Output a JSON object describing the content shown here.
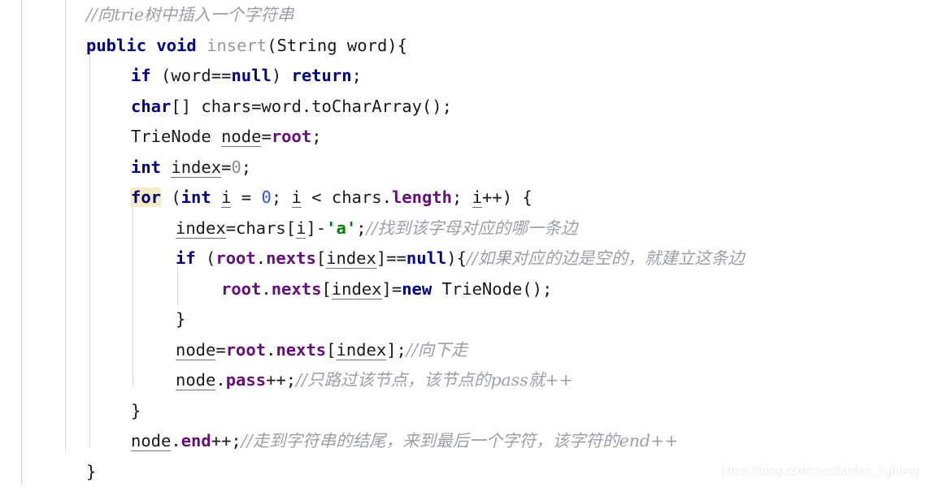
{
  "watermark": {
    "text": "https://blog.csdn.net/fanfan_fighting"
  },
  "colors": {
    "background": "#ffffff",
    "keyword": "#000080",
    "field": "#660e7a",
    "comment": "#9aa0a6",
    "string": "#008000",
    "method": "#9a9a9a",
    "number": "#8f8f8f",
    "highlight": "#f6ebc4",
    "indent_guide": "#d8d8d8",
    "watermark": "#eeeeee"
  },
  "editor": {
    "language": "Java",
    "indent_guides": 5,
    "highlighted_token": "for"
  },
  "code": {
    "lines": [
      {
        "indent": "i1",
        "tokens": [
          {
            "cls": "tk-comment",
            "text": "//向trie树中插入一个字符串"
          }
        ]
      },
      {
        "indent": "i1",
        "tokens": [
          {
            "cls": "tk-keyword",
            "text": "public"
          },
          {
            "cls": "tk-plain",
            "text": " "
          },
          {
            "cls": "tk-keyword",
            "text": "void"
          },
          {
            "cls": "tk-plain",
            "text": " "
          },
          {
            "cls": "tk-method",
            "text": "insert"
          },
          {
            "cls": "tk-plain",
            "text": "(String word){"
          }
        ]
      },
      {
        "indent": "i2",
        "tokens": [
          {
            "cls": "tk-keyword",
            "text": "if"
          },
          {
            "cls": "tk-plain",
            "text": " (word=="
          },
          {
            "cls": "tk-keyword",
            "text": "null"
          },
          {
            "cls": "tk-plain",
            "text": ") "
          },
          {
            "cls": "tk-keyword",
            "text": "return"
          },
          {
            "cls": "tk-plain",
            "text": ";"
          }
        ]
      },
      {
        "indent": "i2",
        "tokens": [
          {
            "cls": "tk-keyword",
            "text": "char"
          },
          {
            "cls": "tk-plain",
            "text": "[] chars=word.toCharArray();"
          }
        ]
      },
      {
        "indent": "i2",
        "tokens": [
          {
            "cls": "tk-type",
            "text": "TrieNode "
          },
          {
            "cls": "tk-local",
            "text": "node"
          },
          {
            "cls": "tk-plain",
            "text": "="
          },
          {
            "cls": "tk-field",
            "text": "root"
          },
          {
            "cls": "tk-plain",
            "text": ";"
          }
        ]
      },
      {
        "indent": "i2",
        "tokens": [
          {
            "cls": "tk-keyword",
            "text": "int"
          },
          {
            "cls": "tk-plain",
            "text": " "
          },
          {
            "cls": "tk-local",
            "text": "index"
          },
          {
            "cls": "tk-plain",
            "text": "="
          },
          {
            "cls": "tk-num",
            "text": "0"
          },
          {
            "cls": "tk-plain",
            "text": ";"
          }
        ]
      },
      {
        "indent": "i2",
        "tokens": [
          {
            "cls": "tk-keyword tk-hl",
            "text": "for"
          },
          {
            "cls": "tk-plain",
            "text": " ("
          },
          {
            "cls": "tk-keyword",
            "text": "int"
          },
          {
            "cls": "tk-plain",
            "text": " "
          },
          {
            "cls": "tk-local",
            "text": "i"
          },
          {
            "cls": "tk-plain",
            "text": " = "
          },
          {
            "cls": "tk-numblue",
            "text": "0"
          },
          {
            "cls": "tk-plain",
            "text": "; "
          },
          {
            "cls": "tk-local",
            "text": "i"
          },
          {
            "cls": "tk-plain",
            "text": " < chars."
          },
          {
            "cls": "tk-field",
            "text": "length"
          },
          {
            "cls": "tk-plain",
            "text": "; "
          },
          {
            "cls": "tk-local",
            "text": "i"
          },
          {
            "cls": "tk-plain",
            "text": "++) {"
          }
        ]
      },
      {
        "indent": "i3",
        "tokens": [
          {
            "cls": "tk-local",
            "text": "index"
          },
          {
            "cls": "tk-plain",
            "text": "=chars["
          },
          {
            "cls": "tk-local",
            "text": "i"
          },
          {
            "cls": "tk-plain",
            "text": "]-"
          },
          {
            "cls": "tk-string",
            "text": "'a'"
          },
          {
            "cls": "tk-plain",
            "text": ";"
          },
          {
            "cls": "tk-comment",
            "text": "//找到该字母对应的哪一条边"
          }
        ]
      },
      {
        "indent": "i3",
        "tokens": [
          {
            "cls": "tk-keyword",
            "text": "if"
          },
          {
            "cls": "tk-plain",
            "text": " ("
          },
          {
            "cls": "tk-field",
            "text": "root"
          },
          {
            "cls": "tk-plain",
            "text": "."
          },
          {
            "cls": "tk-field",
            "text": "nexts"
          },
          {
            "cls": "tk-plain",
            "text": "["
          },
          {
            "cls": "tk-local",
            "text": "index"
          },
          {
            "cls": "tk-plain",
            "text": "]=="
          },
          {
            "cls": "tk-keyword",
            "text": "null"
          },
          {
            "cls": "tk-plain",
            "text": "){"
          },
          {
            "cls": "tk-comment",
            "text": "//如果对应的边是空的，就建立这条边"
          }
        ]
      },
      {
        "indent": "i4",
        "tokens": [
          {
            "cls": "tk-field",
            "text": "root"
          },
          {
            "cls": "tk-plain",
            "text": "."
          },
          {
            "cls": "tk-field",
            "text": "nexts"
          },
          {
            "cls": "tk-plain",
            "text": "["
          },
          {
            "cls": "tk-local",
            "text": "index"
          },
          {
            "cls": "tk-plain",
            "text": "]="
          },
          {
            "cls": "tk-keyword",
            "text": "new"
          },
          {
            "cls": "tk-plain",
            "text": " TrieNode();"
          }
        ]
      },
      {
        "indent": "i3",
        "tokens": [
          {
            "cls": "tk-plain",
            "text": "}"
          }
        ]
      },
      {
        "indent": "i3",
        "tokens": [
          {
            "cls": "tk-local",
            "text": "node"
          },
          {
            "cls": "tk-plain",
            "text": "="
          },
          {
            "cls": "tk-field",
            "text": "root"
          },
          {
            "cls": "tk-plain",
            "text": "."
          },
          {
            "cls": "tk-field",
            "text": "nexts"
          },
          {
            "cls": "tk-plain",
            "text": "["
          },
          {
            "cls": "tk-local",
            "text": "index"
          },
          {
            "cls": "tk-plain",
            "text": "];"
          },
          {
            "cls": "tk-comment",
            "text": "//向下走"
          }
        ]
      },
      {
        "indent": "i3",
        "tokens": [
          {
            "cls": "tk-local",
            "text": "node"
          },
          {
            "cls": "tk-plain",
            "text": "."
          },
          {
            "cls": "tk-field",
            "text": "pass"
          },
          {
            "cls": "tk-plain",
            "text": "++;"
          },
          {
            "cls": "tk-comment",
            "text": "//只路过该节点，该节点的pass就++"
          }
        ]
      },
      {
        "indent": "i2",
        "tokens": [
          {
            "cls": "tk-plain",
            "text": "}"
          }
        ]
      },
      {
        "indent": "i2",
        "tokens": [
          {
            "cls": "tk-local",
            "text": "node"
          },
          {
            "cls": "tk-plain",
            "text": "."
          },
          {
            "cls": "tk-field",
            "text": "end"
          },
          {
            "cls": "tk-plain",
            "text": "++;"
          },
          {
            "cls": "tk-comment",
            "text": "//走到字符串的结尾，来到最后一个字符，该字符的end++"
          }
        ]
      },
      {
        "indent": "i1",
        "tokens": [
          {
            "cls": "tk-plain",
            "text": "}"
          }
        ]
      }
    ]
  }
}
